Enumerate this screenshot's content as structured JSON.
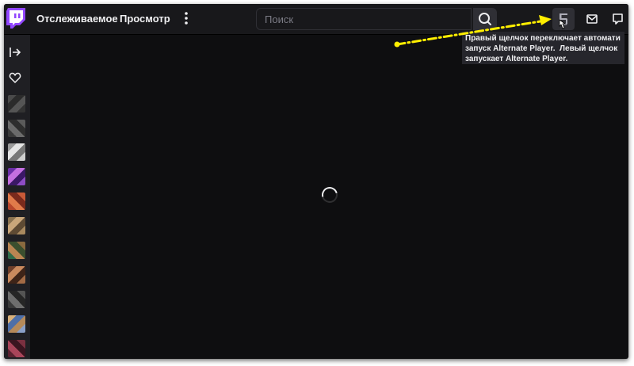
{
  "nav": {
    "following": "Отслеживаемое",
    "browse": "Просмотр"
  },
  "search": {
    "placeholder": "Поиск"
  },
  "tooltip": {
    "text": "Правый щелчок переключает автомати\nзапуск Alternate Player.  Левый щелчок\nзапускает Alternate Player."
  },
  "icons": {
    "logo": "twitch-logo",
    "more": "vertical-ellipsis-icon",
    "search": "search-icon",
    "alternate_player": "alternate-player-icon",
    "inbox": "mail-icon",
    "whispers": "chat-bubble-icon",
    "collapse": "arrow-collapse-icon",
    "followed": "heart-icon",
    "loading": "loading-spinner"
  },
  "colors": {
    "brand": "#9146ff",
    "background": "#0e0e10",
    "topbar": "#18181b",
    "sidebar": "#1f1f23",
    "annotation_arrow": "#ffee00"
  }
}
